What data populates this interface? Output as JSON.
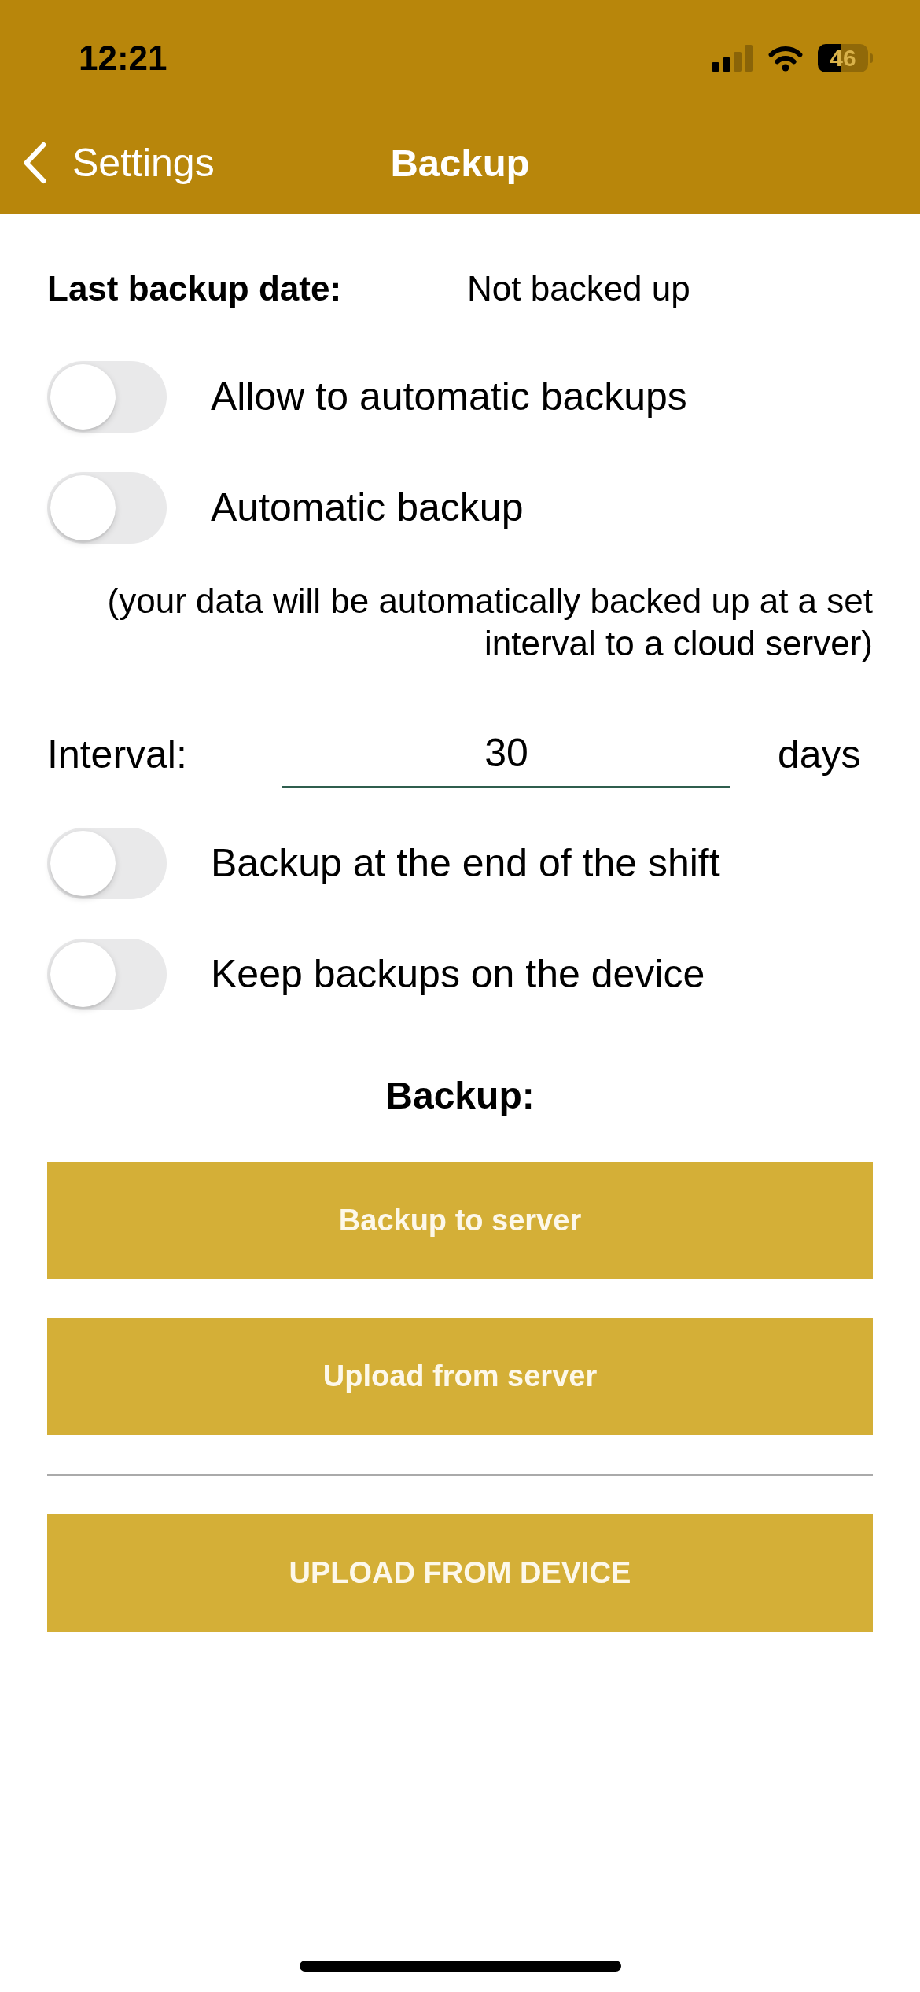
{
  "status_bar": {
    "time": "12:21",
    "battery": "46"
  },
  "nav": {
    "back_label": "Settings",
    "title": "Backup"
  },
  "last_backup": {
    "label": "Last backup date:",
    "value": "Not backed up"
  },
  "options": [
    {
      "kind": "toggle",
      "label": "Allow to automatic backups",
      "on": false
    },
    {
      "kind": "toggle",
      "label": "Automatic backup",
      "on": false
    },
    {
      "kind": "note",
      "text": "(your data will be automatically backed up at a set interval to a cloud server)"
    },
    {
      "kind": "interval",
      "label": "Interval:",
      "value": "30",
      "unit": "days"
    },
    {
      "kind": "toggle",
      "label": "Backup at the end of the shift",
      "on": false
    },
    {
      "kind": "toggle",
      "label": "Keep backups on the device",
      "on": false
    }
  ],
  "section_title": "Backup:",
  "actions": [
    {
      "kind": "button",
      "label": "Backup to server"
    },
    {
      "kind": "button",
      "label": "Upload from server"
    },
    {
      "kind": "divider"
    },
    {
      "kind": "button",
      "label": "UPLOAD FROM DEVICE"
    }
  ]
}
